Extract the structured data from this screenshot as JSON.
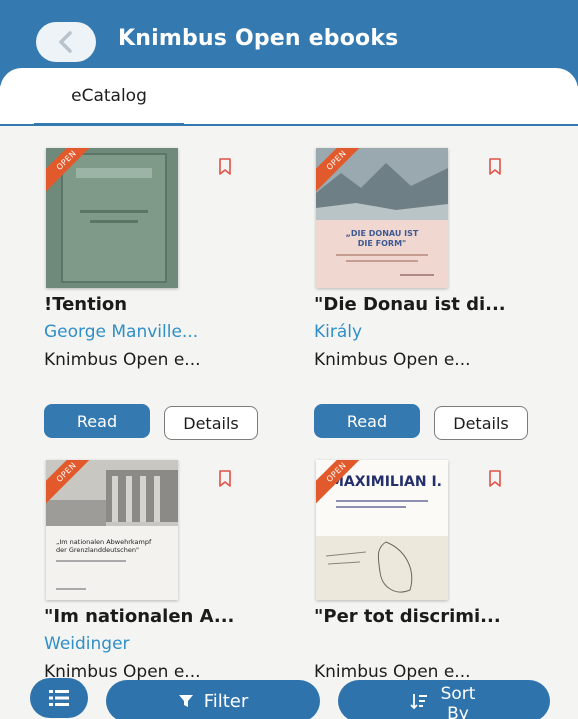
{
  "header": {
    "title": "Knimbus Open ebooks"
  },
  "tabs": [
    {
      "label": "eCatalog"
    }
  ],
  "colors": {
    "primary": "#3479b0",
    "author": "#2f8fc6",
    "ribbon": "#e25a2c",
    "bookmark": "#e0524a"
  },
  "books": [
    {
      "title": "!Tention",
      "author": "George Manville...",
      "source": "Knimbus Open e...",
      "ribbon": "OPEN",
      "read_label": "Read",
      "details_label": "Details",
      "cover_icon": "book-cover-green"
    },
    {
      "title": "\"Die Donau ist di...",
      "author": "Király",
      "source": "Knimbus Open e...",
      "ribbon": "OPEN",
      "read_label": "Read",
      "details_label": "Details",
      "cover_icon": "book-cover-landscape",
      "cover_text": "„DIE DONAU IST DIE FORM\""
    },
    {
      "title": "\"Im nationalen A...",
      "author": "Weidinger",
      "source": "Knimbus Open e...",
      "ribbon": "OPEN",
      "cover_icon": "book-cover-photo",
      "cover_text": "„Im nationalen Abwehrkampf der Grenzlanddeutschen\""
    },
    {
      "title": "\"Per tot discrimi...",
      "author": "",
      "source": "Knimbus Open e...",
      "ribbon": "OPEN",
      "cover_icon": "book-cover-sketch",
      "cover_text": "MAXIMILIAN I."
    }
  ],
  "bottom_bar": {
    "filter_label": "Filter",
    "sort_label": "Sort By"
  }
}
